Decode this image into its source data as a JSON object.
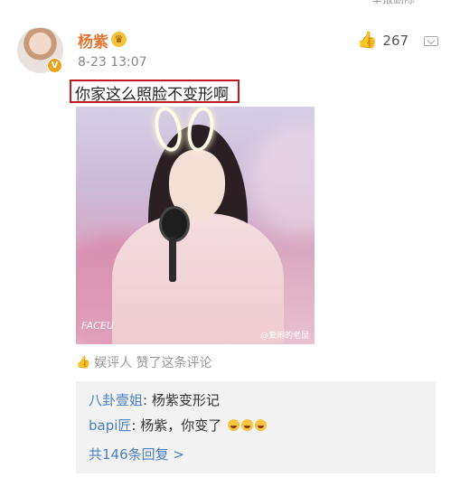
{
  "post": {
    "username": "杨紫",
    "timestamp": "8-23 13:07",
    "like_count": "267",
    "verified_mark": "V",
    "comment": "你家这么照脸不变形啊"
  },
  "photo": {
    "logo_text": "FACEU",
    "watermark_text": "@爱闹的老鼠"
  },
  "liked_by": {
    "text": "娱评人 赞了这条评论"
  },
  "replies": {
    "items": [
      {
        "name": "八卦壹姐",
        "sep": ": ",
        "text": "杨紫变形记"
      },
      {
        "name": "bapi匠",
        "sep": ": ",
        "text": "杨紫，你变了"
      }
    ],
    "more_label": "共146条回复 >"
  }
}
